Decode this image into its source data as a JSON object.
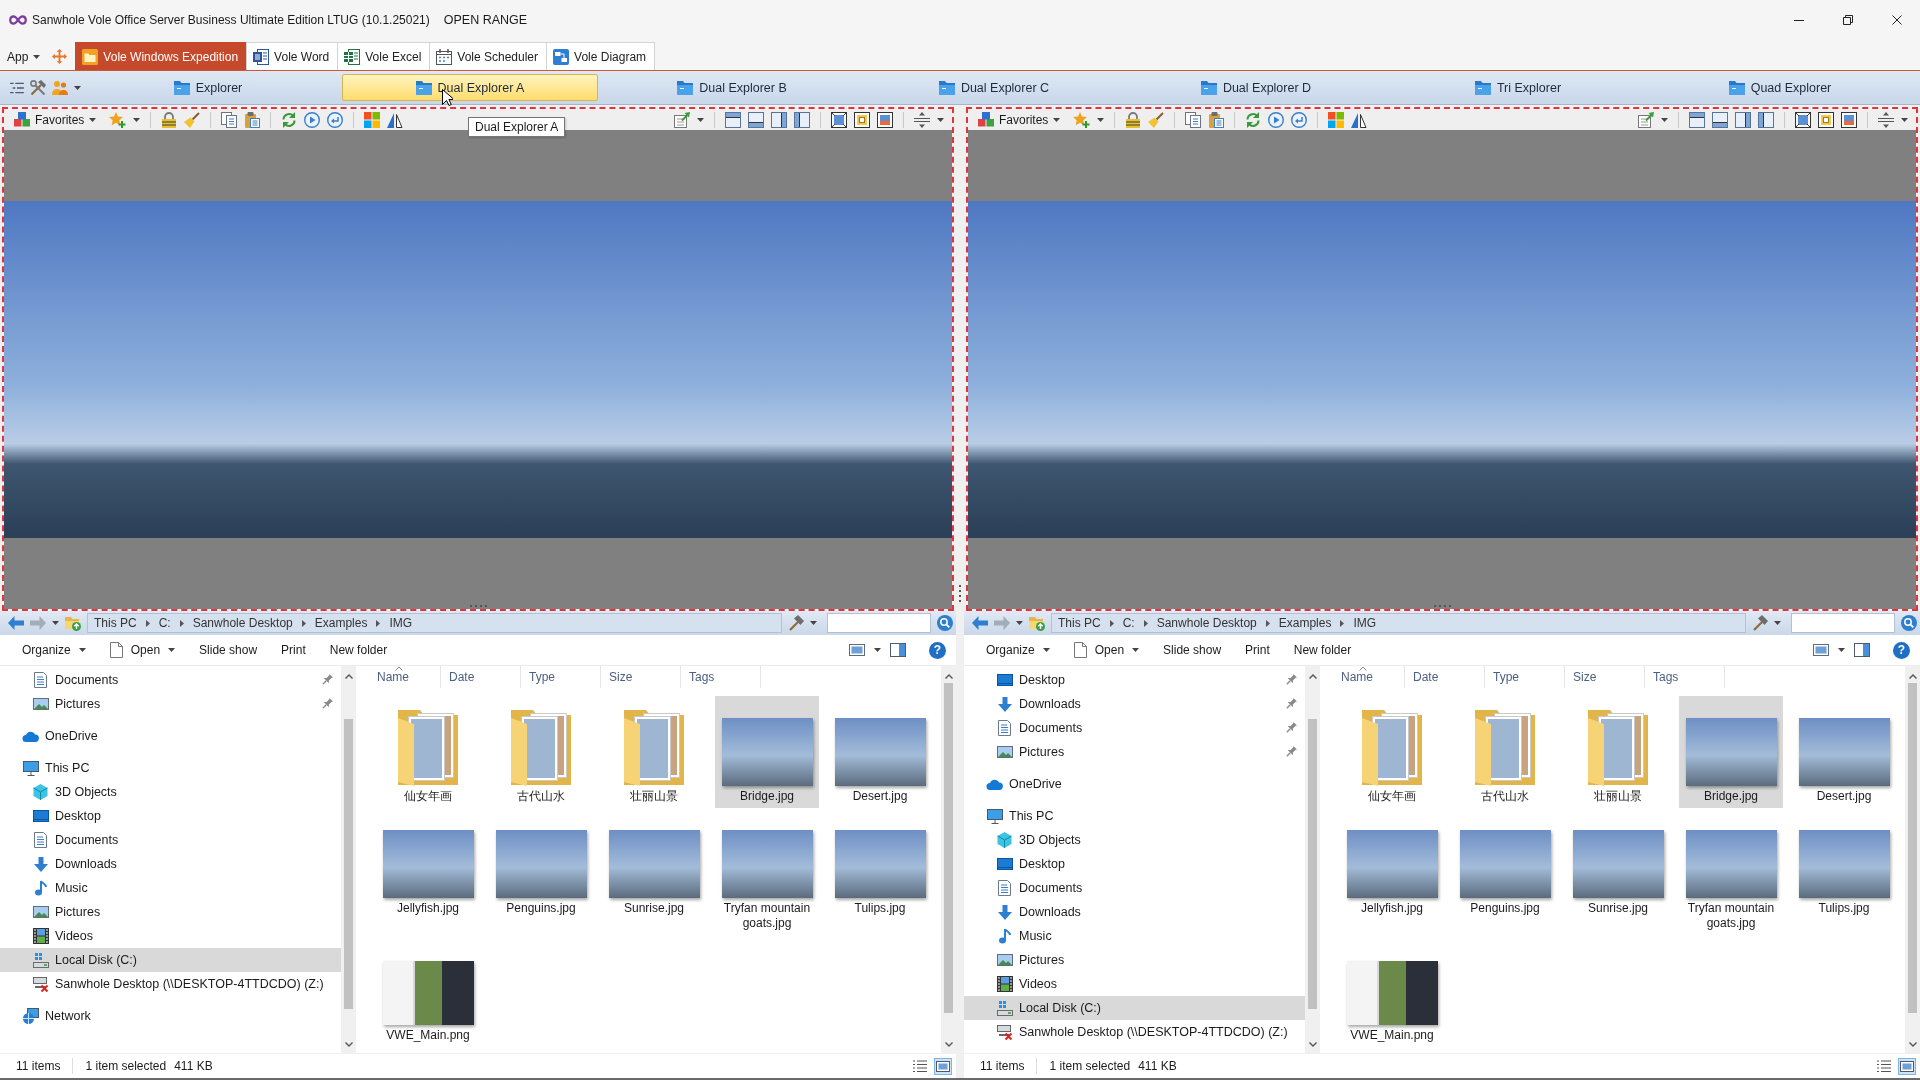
{
  "window": {
    "title": "Sanwhole Vole Office Server Business Ultimate Edition LTUG (10.1.25021)",
    "edition": "OPEN RANGE"
  },
  "ribbon": {
    "app_menu": "App",
    "tabs": [
      {
        "label": "Vole Windows Expedition",
        "kind": "expedition",
        "selected": true
      },
      {
        "label": "Vole Word",
        "kind": "word",
        "selected": false
      },
      {
        "label": "Vole Excel",
        "kind": "excel",
        "selected": false
      },
      {
        "label": "Vole Scheduler",
        "kind": "scheduler",
        "selected": false
      },
      {
        "label": "Vole Diagram",
        "kind": "diagram",
        "selected": false
      }
    ]
  },
  "explorer_tabs": [
    {
      "label": "Explorer",
      "selected": false
    },
    {
      "label": "Dual Explorer A",
      "selected": true
    },
    {
      "label": "Dual Explorer B",
      "selected": false
    },
    {
      "label": "Dual Explorer C",
      "selected": false
    },
    {
      "label": "Dual Explorer D",
      "selected": false
    },
    {
      "label": "Tri Explorer",
      "selected": false
    },
    {
      "label": "Quad Explorer",
      "selected": false
    }
  ],
  "tooltip": "Dual Explorer A",
  "panes": [
    {
      "viewer": {
        "favorites": "Favorites"
      },
      "address": [
        "This PC",
        "C:",
        "Sanwhole Desktop",
        "Examples",
        "IMG"
      ],
      "commands": [
        {
          "label": "Organize",
          "kind": "menu"
        },
        {
          "label": "Open",
          "kind": "split"
        },
        {
          "label": "Slide show",
          "kind": "plain"
        },
        {
          "label": "Print",
          "kind": "plain"
        },
        {
          "label": "New folder",
          "kind": "plain"
        }
      ],
      "help": "?",
      "nav": {
        "quick_access": [
          {
            "label": "Documents",
            "kind": "documents",
            "pinned": true,
            "selected": false
          },
          {
            "label": "Pictures",
            "kind": "pictures",
            "pinned": true,
            "selected": false
          }
        ],
        "tree": [
          {
            "label": "OneDrive",
            "kind": "cloud",
            "selected": false
          },
          {
            "label": "This PC",
            "kind": "pc",
            "selected": false,
            "children": [
              {
                "label": "3D Objects",
                "kind": "objects3d",
                "selected": false
              },
              {
                "label": "Desktop",
                "kind": "desktop",
                "selected": false
              },
              {
                "label": "Documents",
                "kind": "documents",
                "selected": false
              },
              {
                "label": "Downloads",
                "kind": "downloads",
                "selected": false
              },
              {
                "label": "Music",
                "kind": "music",
                "selected": false
              },
              {
                "label": "Pictures",
                "kind": "pictures",
                "selected": false
              },
              {
                "label": "Videos",
                "kind": "videos",
                "selected": false
              },
              {
                "label": "Local Disk (C:)",
                "kind": "disk",
                "selected": true
              },
              {
                "label": "Sanwhole Desktop (\\\\DESKTOP-4TTDCDO) (Z:)",
                "kind": "netdrive",
                "selected": false
              }
            ]
          },
          {
            "label": "Network",
            "kind": "network",
            "selected": false
          }
        ]
      },
      "columns": [
        {
          "label": "Name",
          "sorted": true
        },
        {
          "label": "Date",
          "sorted": false
        },
        {
          "label": "Type",
          "sorted": false
        },
        {
          "label": "Size",
          "sorted": false
        },
        {
          "label": "Tags",
          "sorted": false
        }
      ],
      "files": [
        {
          "name": "仙女年画",
          "kind": "folder",
          "selected": false
        },
        {
          "name": "古代山水",
          "kind": "folder",
          "selected": false
        },
        {
          "name": "壮丽山景",
          "kind": "folder",
          "selected": false
        },
        {
          "name": "Bridge.jpg",
          "kind": "photo",
          "selected": true
        },
        {
          "name": "Desert.jpg",
          "kind": "photo",
          "selected": false
        },
        {
          "name": "Jellyfish.jpg",
          "kind": "photo",
          "selected": false
        },
        {
          "name": "Penguins.jpg",
          "kind": "photo",
          "selected": false
        },
        {
          "name": "Sunrise.jpg",
          "kind": "photo",
          "selected": false
        },
        {
          "name": "Tryfan mountain goats.jpg",
          "kind": "photo",
          "selected": false
        },
        {
          "name": "Tulips.jpg",
          "kind": "photo",
          "selected": false
        },
        {
          "name": "VWE_Main.png",
          "kind": "screenshot",
          "selected": false
        }
      ],
      "status": {
        "count": "11 items",
        "selection": "1 item selected",
        "size": "411 KB",
        "views": [
          {
            "kind": "details",
            "selected": false
          },
          {
            "kind": "large",
            "selected": true
          }
        ]
      }
    },
    {
      "viewer": {
        "favorites": "Favorites"
      },
      "address": [
        "This PC",
        "C:",
        "Sanwhole Desktop",
        "Examples",
        "IMG"
      ],
      "commands": [
        {
          "label": "Organize",
          "kind": "menu"
        },
        {
          "label": "Open",
          "kind": "split"
        },
        {
          "label": "Slide show",
          "kind": "plain"
        },
        {
          "label": "Print",
          "kind": "plain"
        },
        {
          "label": "New folder",
          "kind": "plain"
        }
      ],
      "help": "?",
      "nav": {
        "quick_access": [
          {
            "label": "Desktop",
            "kind": "desktop",
            "pinned": true,
            "selected": false
          },
          {
            "label": "Downloads",
            "kind": "downloads",
            "pinned": true,
            "selected": false
          },
          {
            "label": "Documents",
            "kind": "documents",
            "pinned": true,
            "selected": false
          },
          {
            "label": "Pictures",
            "kind": "pictures",
            "pinned": true,
            "selected": false
          }
        ],
        "tree": [
          {
            "label": "OneDrive",
            "kind": "cloud",
            "selected": false
          },
          {
            "label": "This PC",
            "kind": "pc",
            "selected": false,
            "children": [
              {
                "label": "3D Objects",
                "kind": "objects3d",
                "selected": false
              },
              {
                "label": "Desktop",
                "kind": "desktop",
                "selected": false
              },
              {
                "label": "Documents",
                "kind": "documents",
                "selected": false
              },
              {
                "label": "Downloads",
                "kind": "downloads",
                "selected": false
              },
              {
                "label": "Music",
                "kind": "music",
                "selected": false
              },
              {
                "label": "Pictures",
                "kind": "pictures",
                "selected": false
              },
              {
                "label": "Videos",
                "kind": "videos",
                "selected": false
              },
              {
                "label": "Local Disk (C:)",
                "kind": "disk",
                "selected": true
              },
              {
                "label": "Sanwhole Desktop (\\\\DESKTOP-4TTDCDO) (Z:)",
                "kind": "netdrive",
                "selected": false
              }
            ]
          }
        ]
      },
      "columns": [
        {
          "label": "Name",
          "sorted": true
        },
        {
          "label": "Date",
          "sorted": false
        },
        {
          "label": "Type",
          "sorted": false
        },
        {
          "label": "Size",
          "sorted": false
        },
        {
          "label": "Tags",
          "sorted": false
        }
      ],
      "files": [
        {
          "name": "仙女年画",
          "kind": "folder",
          "selected": false
        },
        {
          "name": "古代山水",
          "kind": "folder",
          "selected": false
        },
        {
          "name": "壮丽山景",
          "kind": "folder",
          "selected": false
        },
        {
          "name": "Bridge.jpg",
          "kind": "photo",
          "selected": true
        },
        {
          "name": "Desert.jpg",
          "kind": "photo",
          "selected": false
        },
        {
          "name": "Jellyfish.jpg",
          "kind": "photo",
          "selected": false
        },
        {
          "name": "Penguins.jpg",
          "kind": "photo",
          "selected": false
        },
        {
          "name": "Sunrise.jpg",
          "kind": "photo",
          "selected": false
        },
        {
          "name": "Tryfan mountain goats.jpg",
          "kind": "photo",
          "selected": false
        },
        {
          "name": "Tulips.jpg",
          "kind": "photo",
          "selected": false
        },
        {
          "name": "VWE_Main.png",
          "kind": "screenshot",
          "selected": false
        }
      ],
      "status": {
        "count": "11 items",
        "selection": "1 item selected",
        "size": "411 KB",
        "views": [
          {
            "kind": "details",
            "selected": false
          },
          {
            "kind": "large",
            "selected": true
          }
        ]
      }
    }
  ]
}
